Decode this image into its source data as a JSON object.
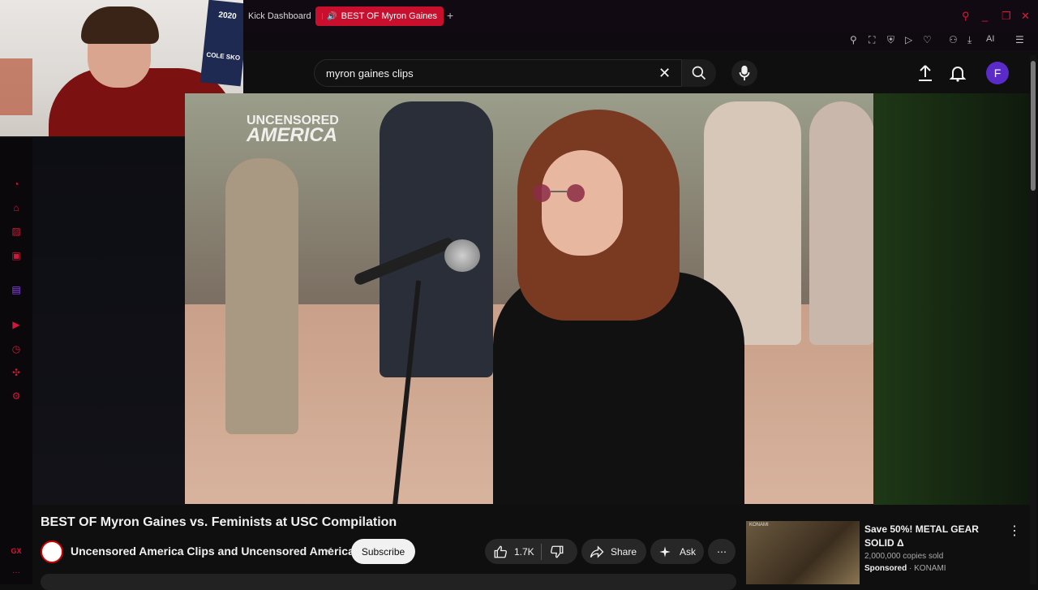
{
  "browser": {
    "tabs": [
      {
        "label": "Kick Dashboard",
        "active": false
      },
      {
        "label": "BEST OF Myron Gaines",
        "active": true
      }
    ],
    "new_tab_label": "+",
    "accent": "#c8102e",
    "ai_label": "AI"
  },
  "webcam": {
    "poster_text": "2020",
    "poster_name": "COLE SKO"
  },
  "sidebar": {
    "bottom_label": "GX",
    "more_label": "···"
  },
  "search": {
    "query": "myron gaines clips",
    "clear_icon": "close-icon",
    "submit_icon": "search-icon"
  },
  "masthead": {
    "avatar_letter": "F",
    "avatar_color": "#5b2bc9"
  },
  "player": {
    "watermark_line1": "UNCENSORED",
    "watermark_line2": "AMERICA"
  },
  "video": {
    "title": "BEST OF Myron Gaines vs. Feminists at USC Compilation",
    "channel_name": "Uncensored America Clips and Uncensored America",
    "verified_icon": "✔",
    "subscribe_label": "Subscribe",
    "likes": "1.7K",
    "share_label": "Share",
    "ask_label": "Ask",
    "more_label": "⋯"
  },
  "ad": {
    "title": "Save 50%! METAL GEAR SOLID Δ",
    "meta": "2,000,000 copies sold",
    "sponsored_label": "Sponsored",
    "advertiser": "KONAMI",
    "thumb_tag": "KONAMI",
    "menu_icon": "⋮"
  }
}
